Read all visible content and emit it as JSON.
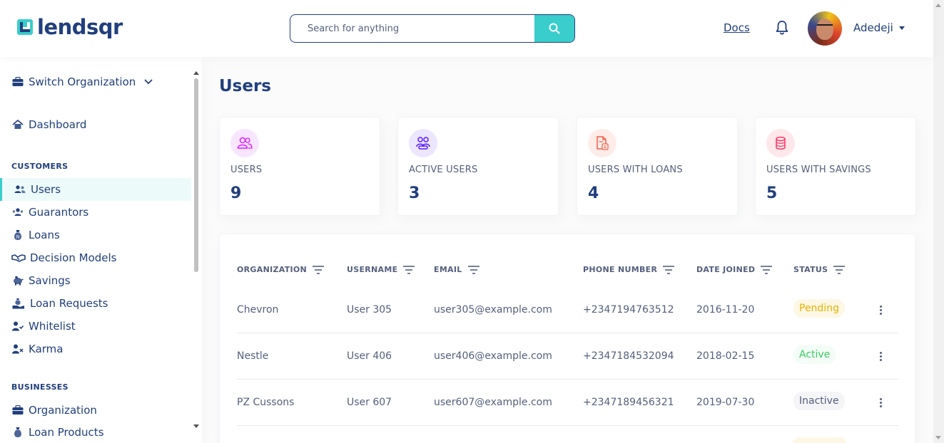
{
  "brand": {
    "name": "lendsqr"
  },
  "search": {
    "placeholder": "Search for anything"
  },
  "header": {
    "docs_label": "Docs",
    "user_name": "Adedeji"
  },
  "sidebar": {
    "switch_org": "Switch Organization",
    "dashboard": "Dashboard",
    "sections": {
      "customers": "CUSTOMERS",
      "businesses": "BUSINESSES"
    },
    "customers": [
      {
        "label": "Users",
        "icon": "users-icon",
        "active": true
      },
      {
        "label": "Guarantors",
        "icon": "guarantors-icon"
      },
      {
        "label": "Loans",
        "icon": "loan-sack-icon"
      },
      {
        "label": "Decision Models",
        "icon": "handshake-icon"
      },
      {
        "label": "Savings",
        "icon": "piggy-bank-icon"
      },
      {
        "label": "Loan Requests",
        "icon": "loan-request-icon"
      },
      {
        "label": "Whitelist",
        "icon": "user-check-icon"
      },
      {
        "label": "Karma",
        "icon": "user-x-icon"
      }
    ],
    "businesses": [
      {
        "label": "Organization",
        "icon": "briefcase-icon"
      },
      {
        "label": "Loan Products",
        "icon": "loan-sack-icon"
      }
    ]
  },
  "main": {
    "title": "Users",
    "stats": [
      {
        "label": "USERS",
        "value": "9",
        "icon": "users-icon",
        "bg": "#f8e6ff",
        "color": "#df18ff"
      },
      {
        "label": "ACTIVE USERS",
        "value": "3",
        "icon": "active-users-icon",
        "bg": "#ece6ff",
        "color": "#5718ff"
      },
      {
        "label": "USERS WITH LOANS",
        "value": "4",
        "icon": "loan-document-icon",
        "bg": "#feece9",
        "color": "#f55f44"
      },
      {
        "label": "USERS WITH SAVINGS",
        "value": "5",
        "icon": "coins-icon",
        "bg": "#ffe8ec",
        "color": "#ff3366"
      }
    ],
    "table": {
      "headers": [
        "ORGANIZATION",
        "USERNAME",
        "EMAIL",
        "PHONE NUMBER",
        "DATE JOINED",
        "STATUS"
      ],
      "rows": [
        {
          "organization": "Chevron",
          "username": "User 305",
          "email": "user305@example.com",
          "phone": "+2347194763512",
          "date": "2016-11-20",
          "status": "Pending"
        },
        {
          "organization": "Nestle",
          "username": "User 406",
          "email": "user406@example.com",
          "phone": "+2347184532094",
          "date": "2018-02-15",
          "status": "Active"
        },
        {
          "organization": "PZ Cussons",
          "username": "User 607",
          "email": "user607@example.com",
          "phone": "+2347189456321",
          "date": "2019-07-30",
          "status": "Inactive"
        }
      ]
    },
    "status_colors": {
      "Pending": {
        "bg": "#fdf7e5",
        "fg": "#e9b200"
      },
      "Active": {
        "bg": "#f3fcf6",
        "fg": "#39cd62"
      },
      "Inactive": {
        "bg": "#f5f5f7",
        "fg": "#545f7d"
      }
    }
  }
}
